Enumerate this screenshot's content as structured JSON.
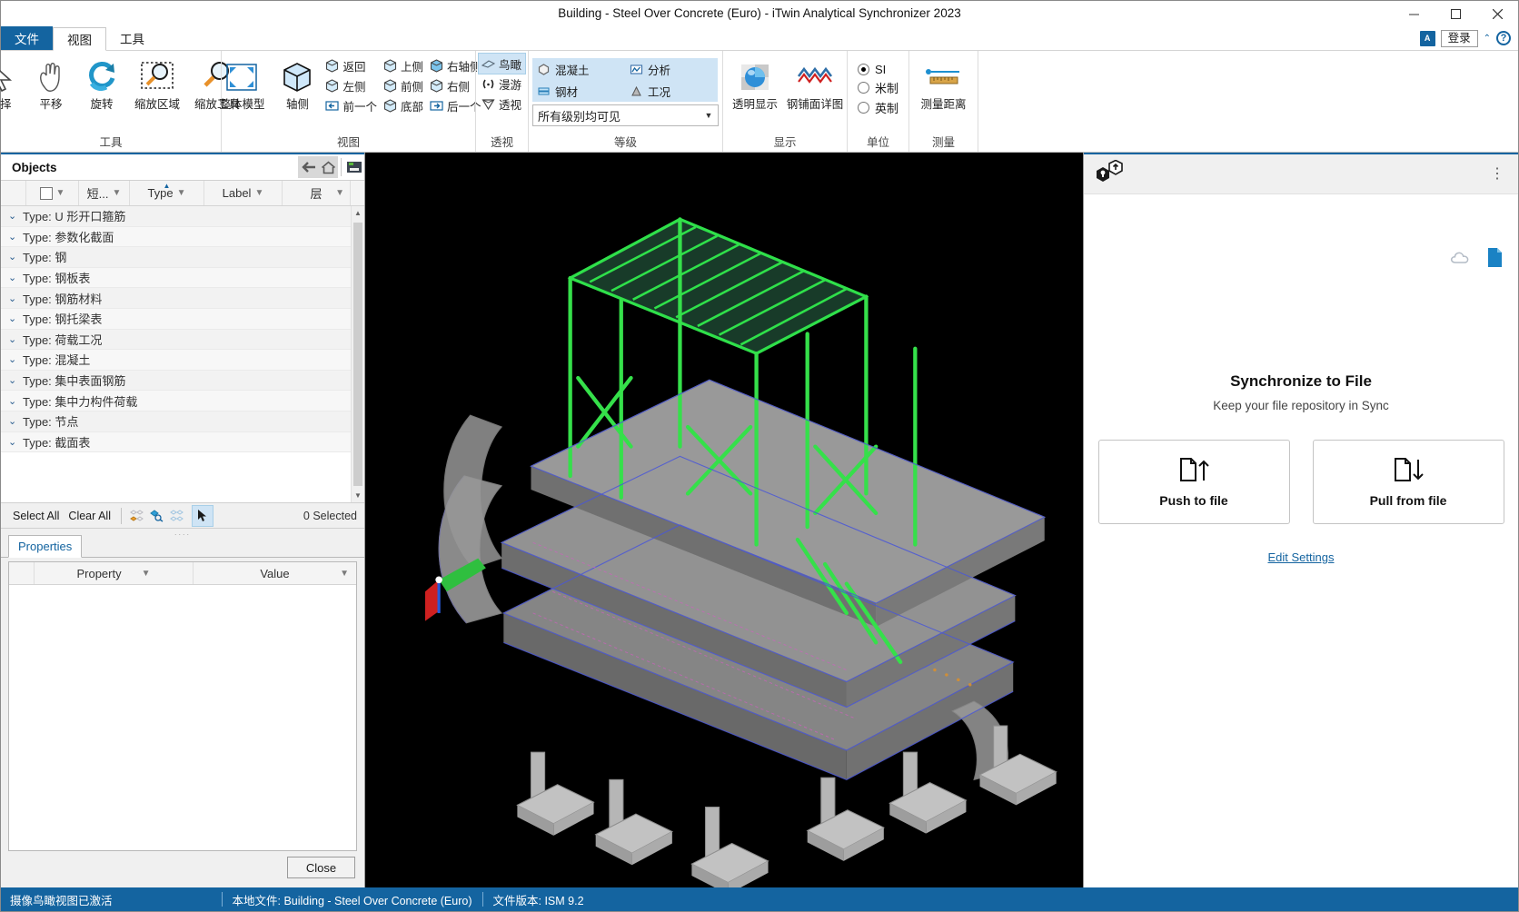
{
  "window": {
    "title": "Building - Steel Over Concrete (Euro) - iTwin Analytical Synchronizer 2023",
    "minimize": "minimize-button",
    "maximize": "maximize-button",
    "close": "close-button"
  },
  "tabs": {
    "file": "文件",
    "view": "视图",
    "tools": "工具",
    "lang_badge": "A",
    "signin": "登录",
    "chevron": "⌃",
    "help": "?"
  },
  "ribbon": {
    "groups": {
      "tools": {
        "label": "工具",
        "buttons": [
          {
            "label": "选择",
            "icon": "cursor-arrow-icon"
          },
          {
            "label": "平移",
            "icon": "pan-hand-icon"
          },
          {
            "label": "旋转",
            "icon": "rotate-icon"
          },
          {
            "label": "缩放区域",
            "icon": "zoom-area-icon"
          },
          {
            "label": "缩放工具",
            "icon": "zoom-tool-icon"
          }
        ]
      },
      "view": {
        "label": "视图",
        "big": [
          {
            "label": "整体模型",
            "icon": "fit-view-icon"
          },
          {
            "label": "轴侧",
            "icon": "isometric-cube-icon"
          }
        ],
        "small": [
          {
            "label": "返回",
            "icon": "cube-back-icon"
          },
          {
            "label": "左侧",
            "icon": "cube-left-icon"
          },
          {
            "label": "前一个",
            "icon": "arrow-left-icon"
          },
          {
            "label": "上侧",
            "icon": "cube-top-icon"
          },
          {
            "label": "前侧",
            "icon": "cube-front-icon"
          },
          {
            "label": "底部",
            "icon": "cube-bottom-icon"
          },
          {
            "label": "右轴侧",
            "icon": "cube-right-iso-icon"
          },
          {
            "label": "右侧",
            "icon": "cube-right-icon"
          },
          {
            "label": "后一个",
            "icon": "arrow-right-icon"
          }
        ]
      },
      "perspective": {
        "label": "透视",
        "items": [
          {
            "label": "鸟瞰",
            "icon": "birdseye-icon",
            "active": true
          },
          {
            "label": "漫游",
            "icon": "walkthrough-icon",
            "active": false
          },
          {
            "label": "透视",
            "icon": "perspective-icon",
            "active": false
          }
        ]
      },
      "levels": {
        "label": "等级",
        "buttons": [
          {
            "label": "混凝土",
            "icon": "concrete-icon"
          },
          {
            "label": "分析",
            "icon": "analysis-icon"
          },
          {
            "label": "钢材",
            "icon": "steel-icon"
          },
          {
            "label": "工况",
            "icon": "loadcase-icon"
          }
        ],
        "select_value": "所有级别均可见"
      },
      "display": {
        "label": "显示",
        "buttons": [
          {
            "label": "透明显示",
            "icon": "transparent-sphere-icon"
          },
          {
            "label": "钢铺面详图",
            "icon": "steel-deck-icon"
          }
        ]
      },
      "units": {
        "label": "单位",
        "options": [
          {
            "label": "SI",
            "selected": true
          },
          {
            "label": "米制",
            "selected": false
          },
          {
            "label": "英制",
            "selected": false
          }
        ]
      },
      "measure": {
        "label": "测量",
        "buttons": [
          {
            "label": "测量距离",
            "icon": "measure-distance-icon"
          }
        ]
      }
    }
  },
  "objects_panel": {
    "title": "Objects",
    "head_icons": [
      "back-arrow-icon",
      "home-icon",
      "search-icon"
    ],
    "columns": [
      {
        "label": "",
        "kind": "checkbox"
      },
      {
        "label": "短...",
        "kind": "text"
      },
      {
        "label": "Type",
        "kind": "text",
        "sorted": true
      },
      {
        "label": "Label",
        "kind": "text"
      },
      {
        "label": "层",
        "kind": "text"
      }
    ],
    "rows": [
      {
        "label": "Type: U 形开口箍筋"
      },
      {
        "label": "Type: 参数化截面"
      },
      {
        "label": "Type: 钢"
      },
      {
        "label": "Type: 钢板表"
      },
      {
        "label": "Type: 钢筋材料"
      },
      {
        "label": "Type: 钢托梁表"
      },
      {
        "label": "Type: 荷载工况"
      },
      {
        "label": "Type: 混凝土"
      },
      {
        "label": "Type: 集中表面钢筋"
      },
      {
        "label": "Type: 集中力构件荷载"
      },
      {
        "label": "Type: 节点"
      },
      {
        "label": "Type: 截面表"
      }
    ],
    "select_all": "Select All",
    "clear_all": "Clear All",
    "toolbar_icons": [
      "select-by-filter-icon",
      "find-objects-icon",
      "invert-selection-icon",
      "pointer-select-icon"
    ],
    "selected_count": "0 Selected"
  },
  "properties_panel": {
    "tab": "Properties",
    "columns": [
      "Property",
      "Value"
    ],
    "rows": [],
    "close_button": "Close"
  },
  "sync_panel": {
    "logo": "itwin-sync-logo-icon",
    "kebab": "more-options-icon",
    "cloud_icon": "cloud-icon",
    "file_icon": "file-icon",
    "title": "Synchronize to File",
    "subtitle": "Keep your file repository in Sync",
    "cards": [
      {
        "label": "Push to file",
        "icon": "file-up-arrow-icon"
      },
      {
        "label": "Pull from file",
        "icon": "file-down-arrow-icon"
      }
    ],
    "link": "Edit Settings"
  },
  "statusbar": {
    "message": "摄像鸟瞰视图已激活",
    "local_file": "本地文件: Building - Steel Over Concrete (Euro)",
    "file_version": "文件版本: ISM 9.2"
  },
  "colors": {
    "accent": "#1464a0",
    "ribbon_highlight": "#cfe4f5",
    "viewport_bg": "#000000",
    "model_green": "#36e04a",
    "model_gray": "#8a8a8a",
    "model_blue": "#3355cc"
  }
}
